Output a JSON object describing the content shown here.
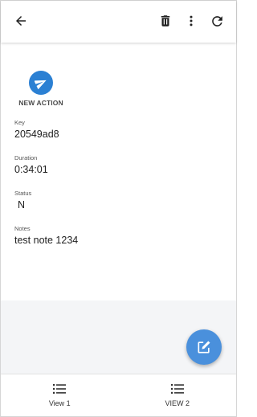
{
  "toolbar": {
    "back_icon": "arrow-back-icon",
    "delete_icon": "trash-icon",
    "more_icon": "more-vertical-icon",
    "refresh_icon": "refresh-icon"
  },
  "action": {
    "label": "NEW ACTION",
    "icon": "paper-plane-icon",
    "color": "#2b80d3"
  },
  "fields": {
    "key": {
      "label": "Key",
      "value": "20549ad8"
    },
    "duration": {
      "label": "Duration",
      "value": "0:34:01"
    },
    "status": {
      "label": "Status",
      "value": "N"
    },
    "notes": {
      "label": "Notes",
      "value": "test note 1234"
    }
  },
  "fab": {
    "icon": "edit-icon",
    "color": "#4a90dc"
  },
  "tabs": [
    {
      "label": "View 1",
      "icon": "list-icon"
    },
    {
      "label": "VIEW 2",
      "icon": "list-icon"
    }
  ]
}
